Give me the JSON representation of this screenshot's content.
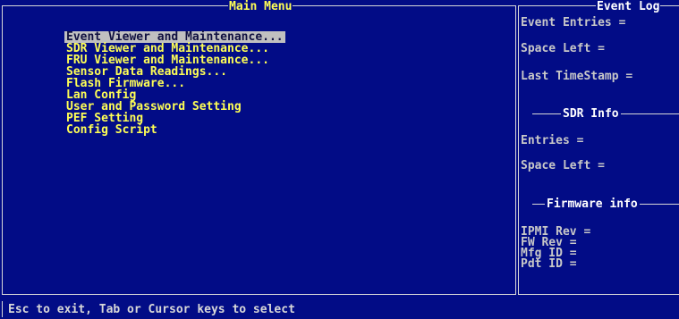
{
  "main_menu": {
    "title": "Main Menu",
    "items": [
      {
        "label": "Event Viewer and Maintenance...",
        "selected": true
      },
      {
        "label": "SDR Viewer and Maintenance..."
      },
      {
        "label": "FRU Viewer and Maintenance..."
      },
      {
        "label": "Sensor Data Readings..."
      },
      {
        "label": "Flash Firmware..."
      },
      {
        "label": "Lan Config"
      },
      {
        "label": "User and Password Setting"
      },
      {
        "label": "PEF Setting"
      },
      {
        "label": "Config Script"
      }
    ]
  },
  "event_log": {
    "title": "Event Log",
    "entries_label": "Event Entries =",
    "space_left_label": "Space Left =",
    "last_timestamp_label": "Last TimeStamp ="
  },
  "sdr_info": {
    "title": "SDR Info",
    "entries_label": "Entries =",
    "space_left_label": "Space Left ="
  },
  "firmware_info": {
    "title": "Firmware info",
    "ipmi_rev_label": "IPMI Rev =",
    "fw_rev_label": "FW Rev =",
    "mfg_id_label": "Mfg ID =",
    "pdt_id_label": "Pdt ID ="
  },
  "status_bar": {
    "text": "Esc to exit, Tab or Cursor keys to select"
  },
  "colors": {
    "background": "#020c86",
    "highlight_text": "#ffff55",
    "normal_text": "#c8c8c8",
    "selection_bg": "#c0c0c0"
  }
}
